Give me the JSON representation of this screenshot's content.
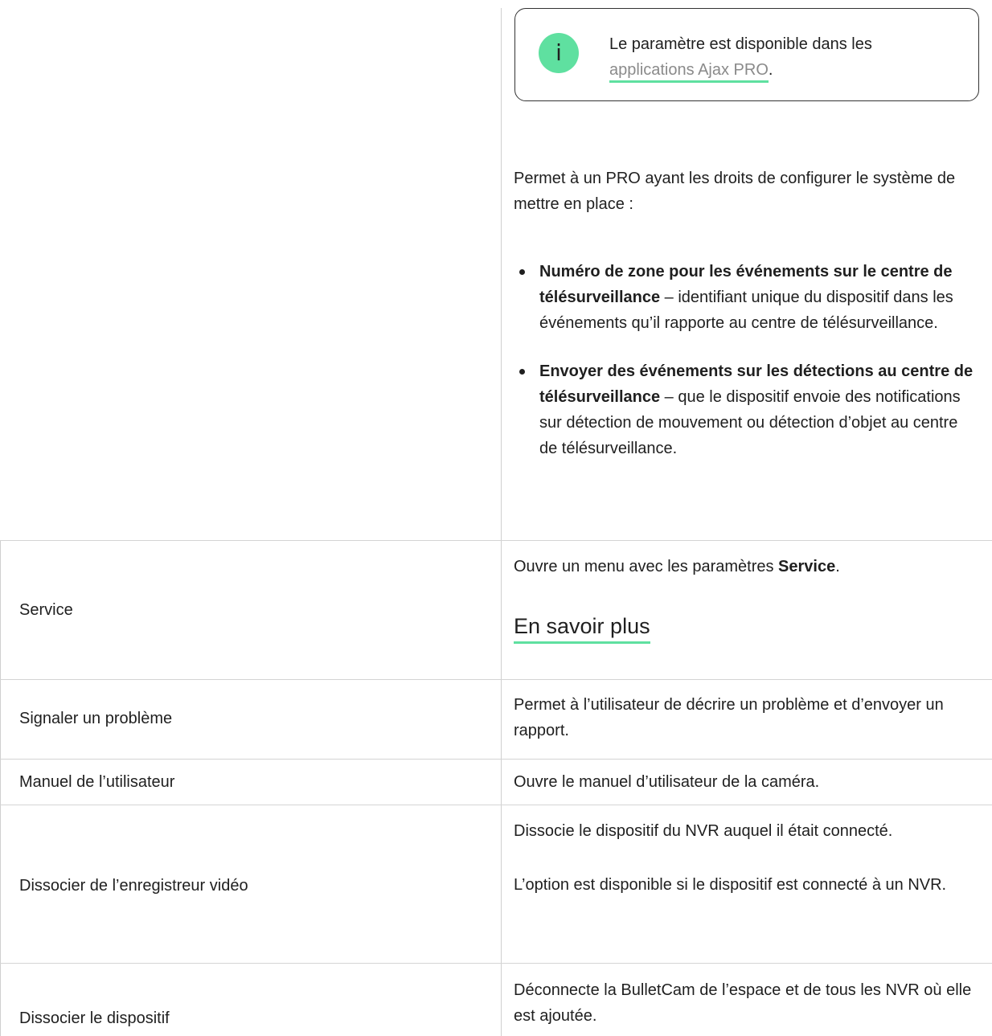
{
  "info_box": {
    "icon": "info-icon",
    "text_before": "Le paramètre est disponible dans les ",
    "link_label": "applications Ajax PRO",
    "text_after": "."
  },
  "pro_settings": {
    "intro": "Permet à un PRO ayant les droits de configurer le système de mettre en place :",
    "bullets": [
      {
        "bold": "Numéro de zone pour les événements sur le centre de télésurveillance",
        "text": " – identifiant unique du dispositif dans les événements qu’il rapporte au centre de télésurveillance."
      },
      {
        "bold": "Envoyer des événements sur les détections au centre de télésurveillance",
        "text": " – que le dispositif envoie des notifications sur détection de mouvement ou détection d’objet au centre de télésurveillance."
      }
    ]
  },
  "rows": {
    "service": {
      "label": "Service",
      "desc_before": "Ouvre un menu avec les paramètres ",
      "desc_bold": "Service",
      "desc_after": ".",
      "link_label": "En savoir plus"
    },
    "report": {
      "label": "Signaler un problème",
      "desc": "Permet à l’utilisateur de décrire un problème et d’envoyer un rapport."
    },
    "manual": {
      "label": "Manuel de l’utilisateur",
      "desc": "Ouvre le manuel d’utilisateur de la caméra."
    },
    "unpair_nvr": {
      "label": "Dissocier de l’enregistreur vidéo",
      "desc1": "Dissocie le dispositif du NVR auquel il était connecté.",
      "desc2": "L’option est disponible si le dispositif est connecté à un NVR."
    },
    "unpair_device": {
      "label": "Dissocier le dispositif",
      "desc": "Déconnecte la BulletCam de l’espace et de tous les NVR où elle est ajoutée."
    }
  },
  "colors": {
    "accent": "#5fe0a0",
    "border": "#d4d4d4",
    "text": "#1f1f1f"
  }
}
